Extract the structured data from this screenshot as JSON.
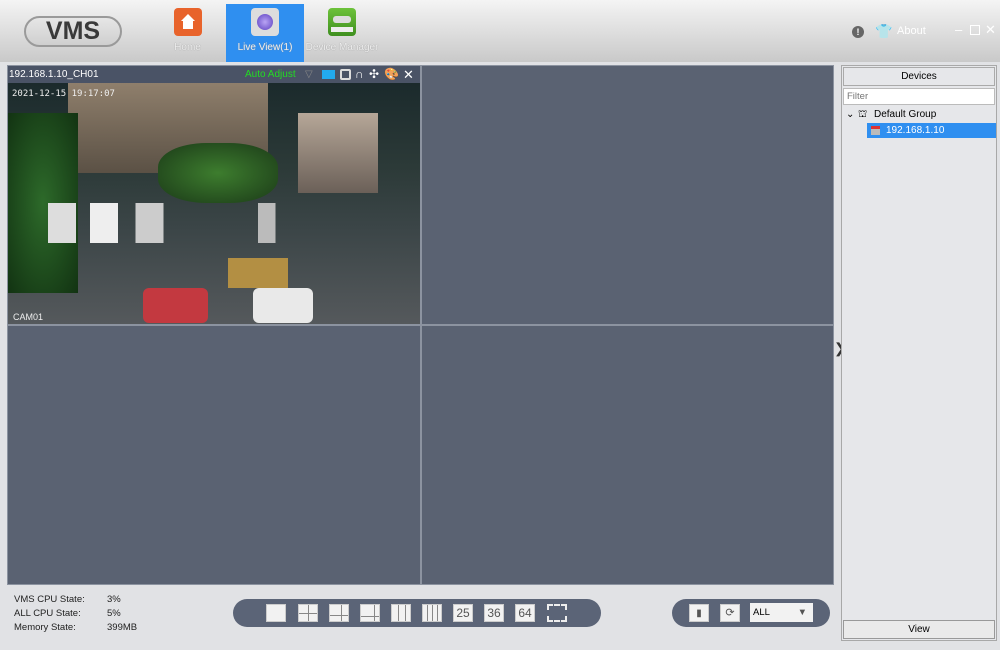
{
  "app": {
    "logo": "VMS"
  },
  "nav": [
    {
      "label": "Home",
      "icon": "home-icon"
    },
    {
      "label": "Live View(1)",
      "icon": "live-view-icon",
      "active": true
    },
    {
      "label": "Device Manager",
      "icon": "device-manager-icon"
    }
  ],
  "header": {
    "about": "About"
  },
  "channel": {
    "title": "192.168.1.10_CH01",
    "adjust": "Auto Adjust",
    "timestamp": "2021-12-15 19:17:07",
    "osd": "CAM01"
  },
  "devices": {
    "title": "Devices",
    "filter_placeholder": "Filter",
    "group": "Default Group",
    "device": "192.168.1.10",
    "view_button": "View"
  },
  "status": {
    "vms_cpu_label": "VMS CPU State:",
    "vms_cpu": "3%",
    "all_cpu_label": "ALL CPU State:",
    "all_cpu": "5%",
    "memory_label": "Memory State:",
    "memory": "399MB"
  },
  "layouts": [
    "1",
    "4",
    "6",
    "8",
    "9",
    "16",
    "25",
    "36",
    "64",
    "fullscreen"
  ],
  "stream": {
    "selected": "ALL"
  },
  "colors": {
    "accent": "#2f8ff0",
    "auto_adjust": "#22dd22",
    "record": "#22aaee"
  }
}
